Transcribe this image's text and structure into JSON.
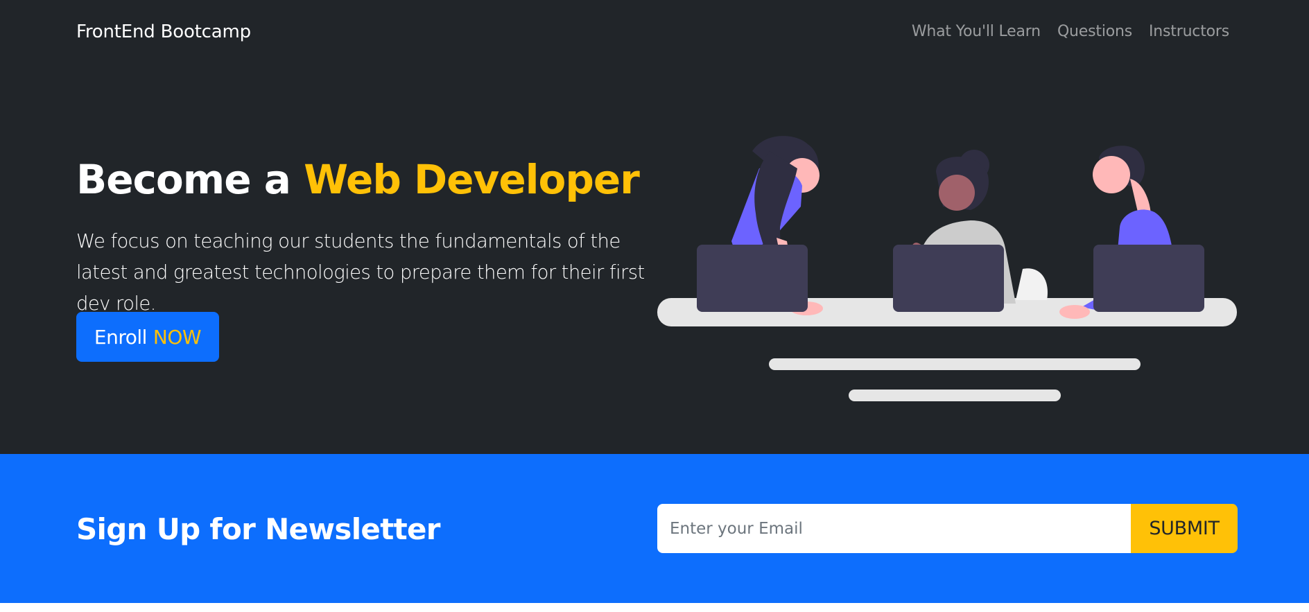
{
  "navbar": {
    "brand": "FrontEnd Bootcamp",
    "links": [
      "What You'll Learn",
      "Questions",
      "Instructors"
    ]
  },
  "hero": {
    "title_start": "Become a ",
    "title_accent": "Web Developer",
    "lead": "We focus on teaching our students the fundamentals of the latest and greatest technologies to prepare them for their first dev role.",
    "button_label": "Enroll",
    "button_accent": "NOW",
    "illustration": "team-at-laptops-illustration"
  },
  "newsletter": {
    "title": "Sign Up for Newsletter",
    "email_placeholder": "Enter your Email",
    "submit_label": "SUBMIT"
  },
  "colors": {
    "dark": "#212529",
    "primary": "#0d6efd",
    "warning": "#ffc107",
    "purple": "#6c63ff"
  }
}
